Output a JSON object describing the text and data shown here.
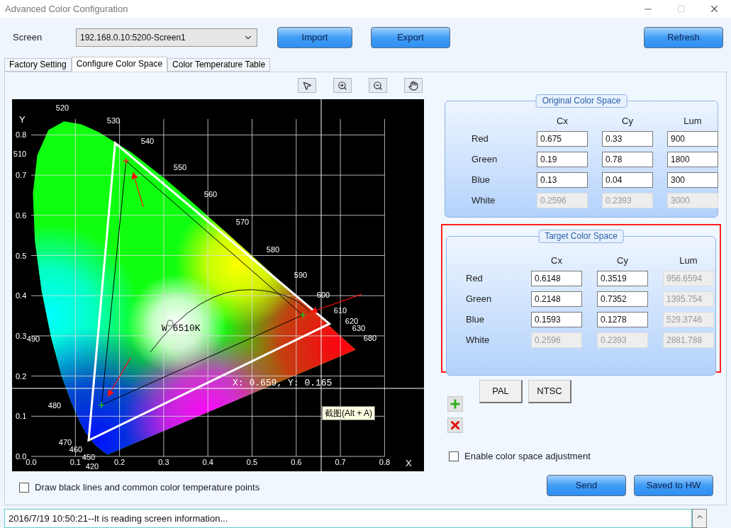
{
  "window": {
    "title": "Advanced Color Configuration"
  },
  "screen": {
    "label": "Screen",
    "value": "192.168.0.10:5200-Screen1"
  },
  "top_buttons": [
    "Import",
    "Export",
    "Refresh"
  ],
  "tabs": [
    {
      "label": "Factory Setting",
      "selected": false
    },
    {
      "label": "Configure Color Space",
      "selected": true
    },
    {
      "label": "Color Temperature Table",
      "selected": false
    }
  ],
  "diagram": {
    "y_axis": "Y",
    "x_axis": "X",
    "yticks": [
      "0.8",
      "0.7",
      "0.6",
      "0.5",
      "0.4",
      "0.3",
      "0.2",
      "0.1",
      "0.0"
    ],
    "xticks": [
      "0.0",
      "0.1",
      "0.2",
      "0.3",
      "0.4",
      "0.5",
      "0.6",
      "0.7",
      "0.8"
    ],
    "wavelengths": [
      "520",
      "530",
      "540",
      "550",
      "560",
      "570",
      "580",
      "590",
      "600",
      "610",
      "620",
      "630",
      "680",
      "510",
      "490",
      "480",
      "470",
      "460",
      "450",
      "420"
    ],
    "white_point": "W 6510K",
    "cursor_readout": "X: 0.659, Y: 0.165",
    "tooltip": "截图(Alt + A)"
  },
  "draw_lines_option": {
    "label": "Draw black lines and common color temperature points",
    "checked": false
  },
  "original_color_space": {
    "title": "Original Color Space",
    "columns": [
      "Cx",
      "Cy",
      "Lum"
    ],
    "rows": [
      {
        "label": "Red",
        "values": [
          {
            "value": "0.675",
            "disabled": false
          },
          {
            "value": "0.33",
            "disabled": false
          },
          {
            "value": "900",
            "disabled": false
          }
        ]
      },
      {
        "label": "Green",
        "values": [
          {
            "value": "0.19",
            "disabled": false
          },
          {
            "value": "0.78",
            "disabled": false
          },
          {
            "value": "1800",
            "disabled": false
          }
        ]
      },
      {
        "label": "Blue",
        "values": [
          {
            "value": "0.13",
            "disabled": false
          },
          {
            "value": "0.04",
            "disabled": false
          },
          {
            "value": "300",
            "disabled": false
          }
        ]
      },
      {
        "label": "White",
        "values": [
          {
            "value": "0.2596",
            "disabled": true
          },
          {
            "value": "0.2393",
            "disabled": true
          },
          {
            "value": "3000",
            "disabled": true
          }
        ]
      }
    ]
  },
  "target_color_space": {
    "title": "Target Color Space",
    "highlighted": true,
    "columns": [
      "Cx",
      "Cy",
      "Lum"
    ],
    "rows": [
      {
        "label": "Red",
        "values": [
          {
            "value": "0.6148",
            "disabled": false
          },
          {
            "value": "0.3519",
            "disabled": false
          },
          {
            "value": "956.6594",
            "disabled": true
          }
        ]
      },
      {
        "label": "Green",
        "values": [
          {
            "value": "0.2148",
            "disabled": false
          },
          {
            "value": "0.7352",
            "disabled": false
          },
          {
            "value": "1395.754",
            "disabled": true
          }
        ]
      },
      {
        "label": "Blue",
        "values": [
          {
            "value": "0.1593",
            "disabled": false
          },
          {
            "value": "0.1278",
            "disabled": false
          },
          {
            "value": "529.3746",
            "disabled": true
          }
        ]
      },
      {
        "label": "White",
        "values": [
          {
            "value": "0.2596",
            "disabled": true
          },
          {
            "value": "0.2393",
            "disabled": true
          },
          {
            "value": "2881.788",
            "disabled": true
          }
        ]
      }
    ]
  },
  "presets": [
    "PAL",
    "NTSC"
  ],
  "enable_adjustment": {
    "label": "Enable color space adjustment",
    "checked": false
  },
  "action_buttons": [
    "Send",
    "Saved to HW"
  ],
  "log": "2016/7/19 10:50:21--It is reading screen information..."
}
